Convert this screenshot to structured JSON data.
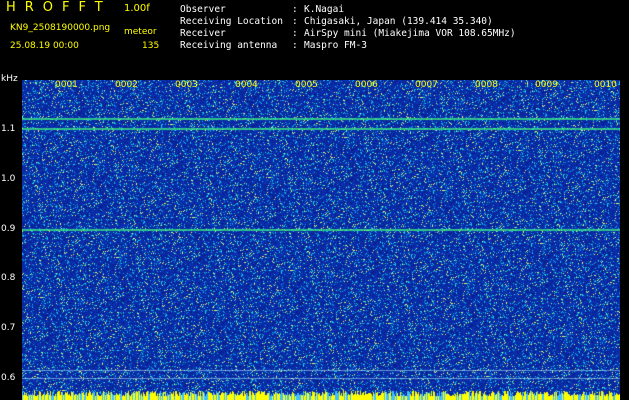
{
  "header": {
    "title": "HROFFT",
    "version": "1.00f",
    "filename": "KN9_2508190000.png",
    "mode": "meteor",
    "datetime": "25.08.19 00:00",
    "count": "135"
  },
  "info": [
    {
      "label": "Observer",
      "value": "K.Nagai"
    },
    {
      "label": "Receiving Location",
      "value": "Chigasaki, Japan (139.414 35.340)"
    },
    {
      "label": "Receiver",
      "value": "AirSpy mini (Miakejima VOR 108.65MHz)"
    },
    {
      "label": "Receiving antenna",
      "value": "Maspro FM-3"
    }
  ],
  "info_separator": ":",
  "axis": {
    "unit": "kHz",
    "y_ticks": [
      "1.1",
      "1.0",
      "0.9",
      "0.8",
      "0.7",
      "0.6"
    ],
    "x_ticks": [
      "0001",
      "0002",
      "0003",
      "0004",
      "0005",
      "0006",
      "0007",
      "0008",
      "0009",
      "0010"
    ]
  },
  "colors": {
    "background": "#000000",
    "header_text": "#ffff00",
    "spectrogram_base": "#0a1aa0",
    "signal_line": "#40ff80",
    "baseline_bar": "#ffff00"
  }
}
